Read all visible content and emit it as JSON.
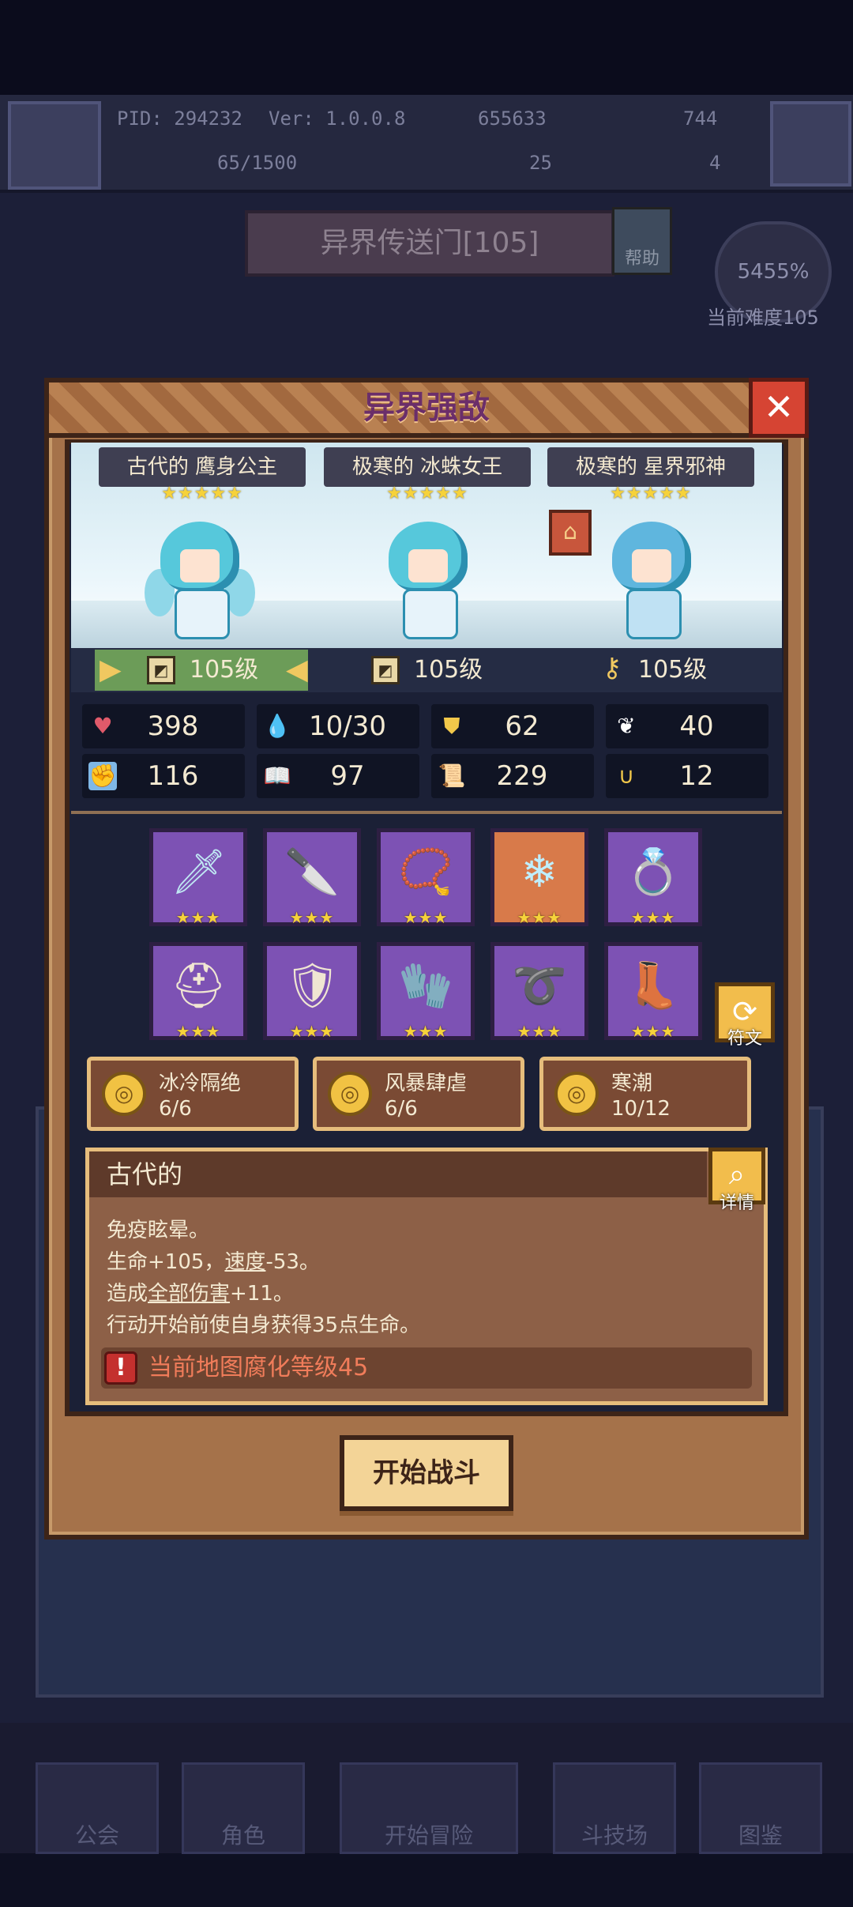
{
  "hud": {
    "pid": "PID: 294232",
    "version": "Ver: 1.0.0.8",
    "exp": "65/1500",
    "gold": "655633",
    "gems": "744",
    "clover": "25",
    "keys": "4"
  },
  "portal": {
    "title": "异界传送门[105]",
    "help_label": "帮助",
    "difficulty_pct": "5455%",
    "difficulty_label": "当前难度105"
  },
  "modal": {
    "title": "异界强敌",
    "close_glyph": "✕"
  },
  "enemies": [
    {
      "name": "古代的 鹰身公主",
      "stars": "★★★★★",
      "level": "105级"
    },
    {
      "name": "极寒的 冰蛛女王",
      "stars": "★★★★★",
      "level": "105级"
    },
    {
      "name": "极寒的 星界邪神",
      "stars": "★★★★★",
      "level": "105级"
    }
  ],
  "stats": [
    {
      "icon": "heart-icon",
      "glyph": "♥",
      "value": "398",
      "color": "#e05a6a"
    },
    {
      "icon": "water-drop-icon",
      "glyph": "💧",
      "value": "10/30",
      "color": "#6fc7ea"
    },
    {
      "icon": "shield-icon",
      "glyph": "⛊",
      "value": "62",
      "color": "#f2c84a"
    },
    {
      "icon": "wing-icon",
      "glyph": "❦",
      "value": "40",
      "color": "#ffffff"
    },
    {
      "icon": "fist-icon",
      "glyph": "✊",
      "value": "116",
      "color": "#e8a08a"
    },
    {
      "icon": "book-icon",
      "glyph": "📖",
      "value": "97",
      "color": "#d8c49a"
    },
    {
      "icon": "scroll-icon",
      "glyph": "📜",
      "value": "229",
      "color": "#e87a3a"
    },
    {
      "icon": "horseshoe-icon",
      "glyph": "∪",
      "value": "12",
      "color": "#f2c84a"
    }
  ],
  "equipment": [
    {
      "name": "sword-icon",
      "glyph": "🗡",
      "stars": "★★★",
      "highlight": false
    },
    {
      "name": "dagger-icon",
      "glyph": "🔪",
      "stars": "★★★",
      "highlight": false
    },
    {
      "name": "amulet-icon",
      "glyph": "📿",
      "stars": "★★★",
      "highlight": false
    },
    {
      "name": "ice-crystal-icon",
      "glyph": "❄",
      "stars": "★★★",
      "highlight": true
    },
    {
      "name": "ring-icon",
      "glyph": "💍",
      "stars": "★★★",
      "highlight": false
    },
    {
      "name": "helmet-icon",
      "glyph": "⛑",
      "stars": "★★★",
      "highlight": false
    },
    {
      "name": "armor-icon",
      "glyph": "🛡",
      "stars": "★★★",
      "highlight": false
    },
    {
      "name": "glove-icon",
      "glyph": "🧤",
      "stars": "★★★",
      "highlight": false
    },
    {
      "name": "belt-icon",
      "glyph": "➰",
      "stars": "★★★",
      "highlight": false
    },
    {
      "name": "boots-icon",
      "glyph": "👢",
      "stars": "★★★",
      "highlight": false
    }
  ],
  "rune_button": {
    "label": "符文",
    "glyph": "⟳"
  },
  "sets": [
    {
      "name": "冰冷隔绝",
      "count": "6/6"
    },
    {
      "name": "风暴肆虐",
      "count": "6/6"
    },
    {
      "name": "寒潮",
      "count": "10/12"
    }
  ],
  "affix": {
    "title": "古代的",
    "detail_label": "详情",
    "line1": "免疫眩晕。",
    "line2_a": "生命+105，",
    "line2_b": "速度",
    "line2_c": "-53。",
    "line3_a": "造成",
    "line3_b": "全部伤害",
    "line3_c": "+11。",
    "line4": "行动开始前使自身获得35点生命。",
    "warning": "当前地图腐化等级45"
  },
  "start_button": "开始战斗",
  "nav": [
    "公会",
    "角色",
    "开始冒险",
    "斗技场",
    "图鉴"
  ]
}
